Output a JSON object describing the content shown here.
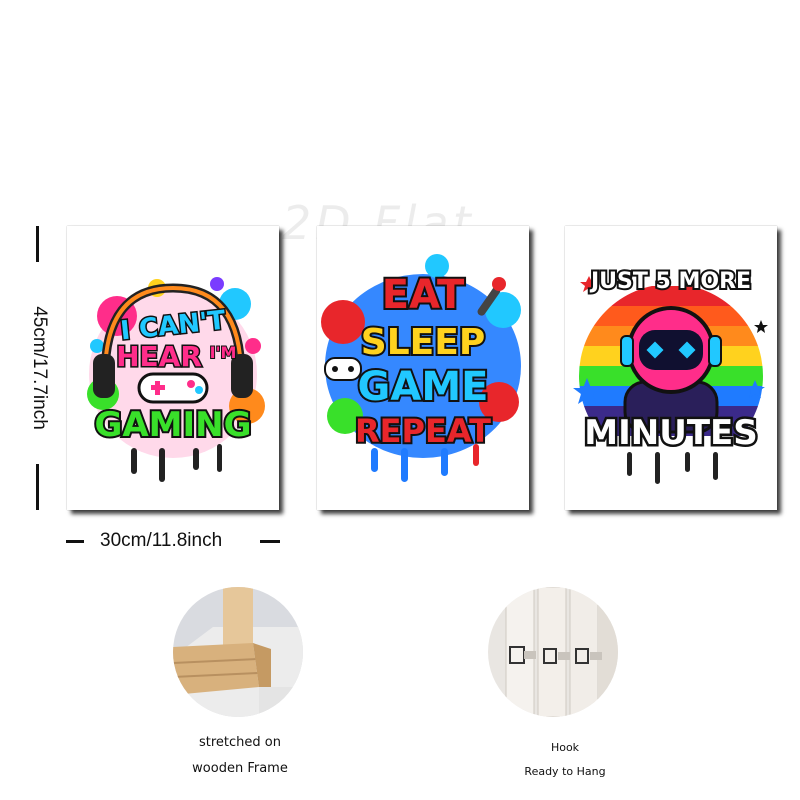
{
  "watermark": "2D Flat",
  "dimensions": {
    "height_label": "45cm/17.7inch",
    "width_label": "30cm/11.8inch"
  },
  "prints": [
    {
      "lines": [
        "I CAN'T",
        "HEAR",
        "I'M",
        "GAMING"
      ],
      "icons": [
        "headphones-icon",
        "gamepad-icon",
        "paint-splash-icon"
      ]
    },
    {
      "lines": [
        "EAT",
        "SLEEP",
        "GAME",
        "REPEAT"
      ],
      "icons": [
        "gamepad-icon",
        "microphone-icon",
        "paint-drip-icon"
      ]
    },
    {
      "lines": [
        "JUST 5 MORE",
        "MINUTES"
      ],
      "icons": [
        "astronaut-gamer-icon",
        "retro-sunset-icon",
        "star-icon"
      ]
    }
  ],
  "details": {
    "frame": {
      "caption_line1": "stretched on",
      "caption_line2": "wooden Frame",
      "icon": "wooden-frame-corner-icon"
    },
    "hook": {
      "caption_line1": "Hook",
      "caption_line2": "Ready to Hang",
      "icon": "hanging-hook-icon"
    }
  },
  "colors": {
    "black": "#111111",
    "pink": "#ff2d8a",
    "cyan": "#21c8ff",
    "green": "#39e02a",
    "red": "#e8262b",
    "yellow": "#ffd21e",
    "blue": "#1f7bff",
    "orange": "#ff8a1c"
  }
}
